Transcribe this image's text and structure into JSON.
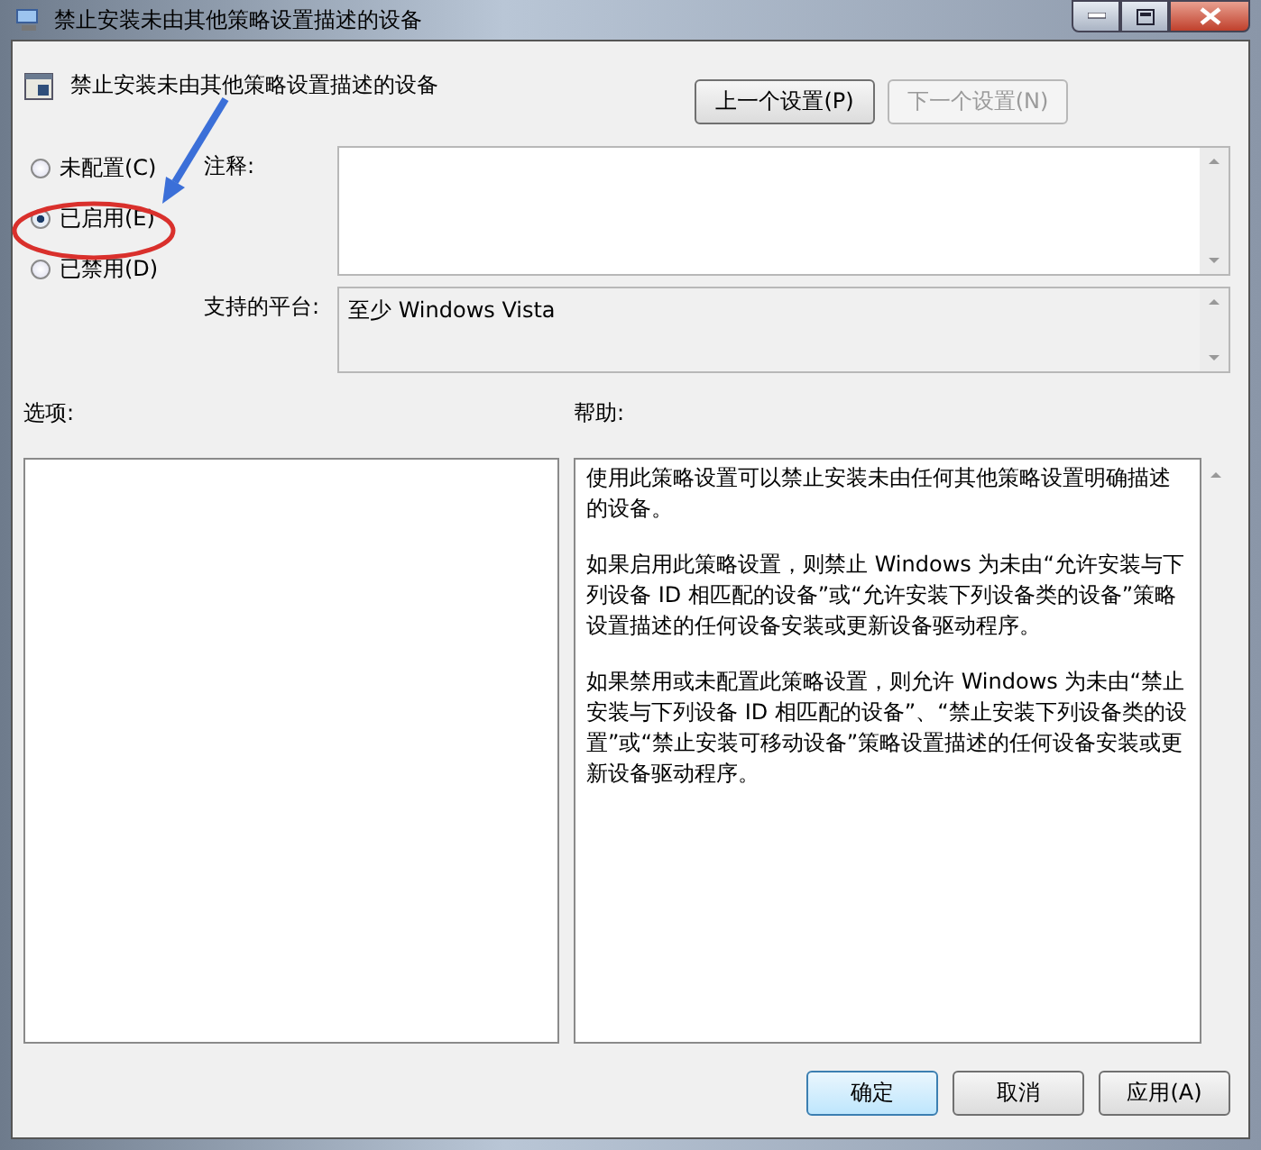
{
  "window": {
    "title": "禁止安装未由其他策略设置描述的设备"
  },
  "policy": {
    "title": "禁止安装未由其他策略设置描述的设备"
  },
  "nav_buttons": [
    {
      "label": "上一个设置(P)",
      "disabled": false
    },
    {
      "label": "下一个设置(N)",
      "disabled": true
    }
  ],
  "state_options": [
    {
      "label": "未配置(C)",
      "selected": false
    },
    {
      "label": "已启用(E)",
      "selected": true
    },
    {
      "label": "已禁用(D)",
      "selected": false
    }
  ],
  "comment": {
    "label": "注释:"
  },
  "platform": {
    "label": "支持的平台:",
    "value": "至少 Windows Vista"
  },
  "options": {
    "label": "选项:"
  },
  "help": {
    "label": "帮助:",
    "paragraphs": [
      "使用此策略设置可以禁止安装未由任何其他策略设置明确描述的设备。",
      "如果启用此策略设置，则禁止 Windows 为未由“允许安装与下列设备 ID 相匹配的设备”或“允许安装下列设备类的设备”策略设置描述的任何设备安装或更新设备驱动程序。",
      "如果禁用或未配置此策略设置，则允许 Windows 为未由“禁止安装与下列设备 ID 相匹配的设备”、“禁止安装下列设备类的设置”或“禁止安装可移动设备”策略设置描述的任何设备安装或更新设备驱动程序。"
    ]
  },
  "footer_buttons": [
    {
      "label": "确定",
      "default": true
    },
    {
      "label": "取消",
      "default": false
    },
    {
      "label": "应用(A)",
      "default": false
    }
  ],
  "annotations": {
    "arrow": true,
    "highlight_ring": true
  }
}
